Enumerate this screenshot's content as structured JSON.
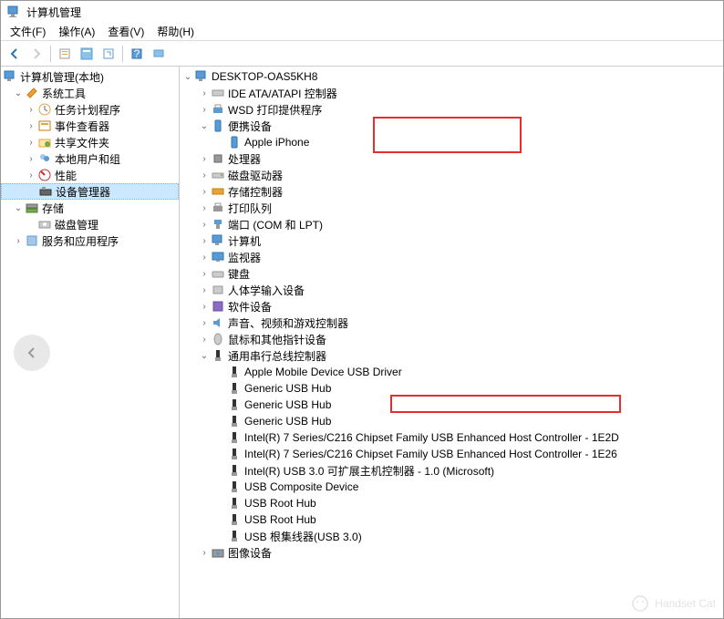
{
  "window": {
    "title": "计算机管理"
  },
  "menu": {
    "file": "文件(F)",
    "action": "操作(A)",
    "view": "查看(V)",
    "help": "帮助(H)"
  },
  "left_tree": {
    "root": "计算机管理(本地)",
    "system_tools": "系统工具",
    "task_scheduler": "任务计划程序",
    "event_viewer": "事件查看器",
    "shared_folders": "共享文件夹",
    "local_users": "本地用户和组",
    "performance": "性能",
    "device_manager": "设备管理器",
    "storage": "存储",
    "disk_management": "磁盘管理",
    "services": "服务和应用程序"
  },
  "right_tree": {
    "root": "DESKTOP-OAS5KH8",
    "ide": "IDE ATA/ATAPI 控制器",
    "wsd": "WSD 打印提供程序",
    "portable": "便携设备",
    "apple_iphone": "Apple iPhone",
    "processor": "处理器",
    "disk_drives": "磁盘驱动器",
    "storage_ctrl": "存储控制器",
    "print_queue": "打印队列",
    "ports": "端口 (COM 和 LPT)",
    "computer": "计算机",
    "monitor": "监视器",
    "keyboard": "键盘",
    "hid": "人体学输入设备",
    "software_dev": "软件设备",
    "sound": "声音、视频和游戏控制器",
    "mouse": "鼠标和其他指针设备",
    "usb_ctrl": "通用串行总线控制器",
    "apple_usb": "Apple Mobile Device USB Driver",
    "hub1": "Generic USB Hub",
    "hub2": "Generic USB Hub",
    "hub3": "Generic USB Hub",
    "intel1": "Intel(R) 7 Series/C216 Chipset Family USB Enhanced Host Controller - 1E2D",
    "intel2": "Intel(R) 7 Series/C216 Chipset Family USB Enhanced Host Controller - 1E26",
    "intel3": "Intel(R) USB 3.0 可扩展主机控制器 - 1.0 (Microsoft)",
    "composite": "USB Composite Device",
    "root1": "USB Root Hub",
    "root2": "USB Root Hub",
    "root3": "USB 根集线器(USB 3.0)",
    "image_dev": "图像设备"
  },
  "watermark": "Handset Cat"
}
